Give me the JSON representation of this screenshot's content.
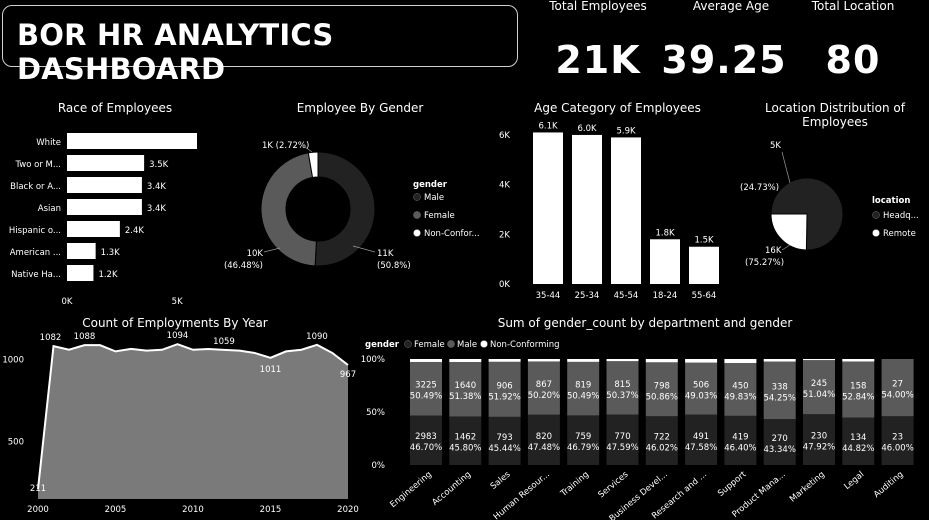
{
  "header": {
    "title": "BOR HR ANALYTICS DASHBOARD"
  },
  "kpis": [
    {
      "label": "Total Employees",
      "value": "21K"
    },
    {
      "label": "Average Age",
      "value": "39.25"
    },
    {
      "label": "Total Location",
      "value": "80"
    }
  ],
  "chart_data": [
    {
      "id": "race",
      "type": "bar",
      "orientation": "horizontal",
      "title": "Race of Employees",
      "categories": [
        "White",
        "Two or M...",
        "Black or A...",
        "Asian",
        "Hispanic o...",
        "American ...",
        "Native Ha..."
      ],
      "values": [
        5.9,
        3.5,
        3.4,
        3.4,
        2.4,
        1.3,
        1.2
      ],
      "value_labels": [
        "",
        "3.5K",
        "3.4K",
        "3.4K",
        "2.4K",
        "1.3K",
        "1.2K"
      ],
      "x_ticks": [
        "0K",
        "5K"
      ],
      "xlim": [
        0,
        5.9
      ]
    },
    {
      "id": "gender",
      "type": "pie",
      "variant": "donut",
      "title": "Employee By Gender",
      "legend_title": "gender",
      "legend_position": "right",
      "slices": [
        {
          "name": "Male",
          "value": 50.8,
          "label": "11K",
          "pct": "(50.8%)",
          "color": "#222222"
        },
        {
          "name": "Female",
          "value": 46.48,
          "label": "10K",
          "pct": "(46.48%)",
          "color": "#5a5a5a"
        },
        {
          "name": "Non-Confor...",
          "value": 2.72,
          "label": "1K (2.72%)",
          "pct": "",
          "color": "#ffffff"
        }
      ]
    },
    {
      "id": "age",
      "type": "bar",
      "title": "Age Category of Employees",
      "categories": [
        "35-44",
        "25-34",
        "45-54",
        "18-24",
        "55-64"
      ],
      "values": [
        6.1,
        6.0,
        5.9,
        1.8,
        1.5
      ],
      "value_labels": [
        "6.1K",
        "6.0K",
        "5.9K",
        "1.8K",
        "1.5K"
      ],
      "y_ticks": [
        "0K",
        "2K",
        "4K",
        "6K"
      ],
      "ylim": [
        0,
        6.4
      ]
    },
    {
      "id": "location",
      "type": "pie",
      "title": "Location Distribution of Employees",
      "legend_title": "location",
      "legend_position": "right",
      "slices": [
        {
          "name": "Headq...",
          "value": 75.27,
          "label": "16K",
          "pct": "(75.27%)",
          "color": "#222222"
        },
        {
          "name": "Remote",
          "value": 24.73,
          "label": "5K",
          "pct": "(24.73%)",
          "color": "#ffffff"
        }
      ]
    },
    {
      "id": "years",
      "type": "area",
      "title": "Count of Employments By Year",
      "x": [
        2000,
        2001,
        2002,
        2003,
        2004,
        2005,
        2006,
        2007,
        2008,
        2009,
        2010,
        2011,
        2012,
        2013,
        2014,
        2015,
        2016,
        2017,
        2018,
        2019,
        2020
      ],
      "y": [
        211,
        1082,
        1060,
        1088,
        1088,
        1050,
        1065,
        1055,
        1060,
        1094,
        1060,
        1065,
        1059,
        1055,
        1040,
        1011,
        1050,
        1060,
        1090,
        1040,
        967
      ],
      "point_labels": [
        {
          "x": 2000,
          "text": "211"
        },
        {
          "x": 2001,
          "text": "1082"
        },
        {
          "x": 2003,
          "text": "1088"
        },
        {
          "x": 2009,
          "text": "1094"
        },
        {
          "x": 2012,
          "text": "1059"
        },
        {
          "x": 2015,
          "text": "1011"
        },
        {
          "x": 2018,
          "text": "1090"
        },
        {
          "x": 2020,
          "text": "967"
        }
      ],
      "x_ticks": [
        "2000",
        "2005",
        "2010",
        "2015",
        "2020"
      ],
      "y_ticks": [
        "500",
        "1000"
      ],
      "ylim": [
        150,
        1150
      ]
    },
    {
      "id": "dept",
      "type": "bar",
      "variant": "100% stacked",
      "title": "Sum of gender_count by department and gender",
      "legend_title": "gender",
      "legend_position": "top",
      "legend": [
        "Female",
        "Male",
        "Non-Conforming"
      ],
      "categories": [
        "Engineering",
        "Accounting",
        "Sales",
        "Human Resour...",
        "Training",
        "Services",
        "Business Devel...",
        "Research and ...",
        "Support",
        "Product Mana...",
        "Marketing",
        "Legal",
        "Auditing"
      ],
      "series": [
        {
          "name": "Female",
          "values": [
            3225,
            1640,
            906,
            867,
            819,
            815,
            798,
            506,
            450,
            338,
            245,
            158,
            27
          ],
          "pct": [
            "50.49%",
            "51.38%",
            "51.92%",
            "50.20%",
            "50.49%",
            "50.37%",
            "50.86%",
            "49.03%",
            "49.83%",
            "54.25%",
            "51.04%",
            "52.84%",
            "54.00%"
          ]
        },
        {
          "name": "Male",
          "values": [
            2983,
            1462,
            793,
            820,
            759,
            770,
            722,
            491,
            419,
            270,
            230,
            134,
            23
          ],
          "pct": [
            "46.70%",
            "45.80%",
            "45.44%",
            "47.48%",
            "46.79%",
            "47.59%",
            "46.02%",
            "47.58%",
            "46.40%",
            "43.34%",
            "47.92%",
            "44.82%",
            "46.00%"
          ]
        },
        {
          "name": "Non-Conforming",
          "values": [
            179,
            90,
            46,
            40,
            44,
            33,
            49,
            35,
            34,
            15,
            5,
            7,
            0
          ],
          "pct": []
        }
      ],
      "y_ticks": [
        "0%",
        "50%",
        "100%"
      ]
    }
  ],
  "colors": {
    "background": "#000000",
    "dark": "#222222",
    "mid": "#5a5a5a",
    "light": "#ffffff"
  }
}
